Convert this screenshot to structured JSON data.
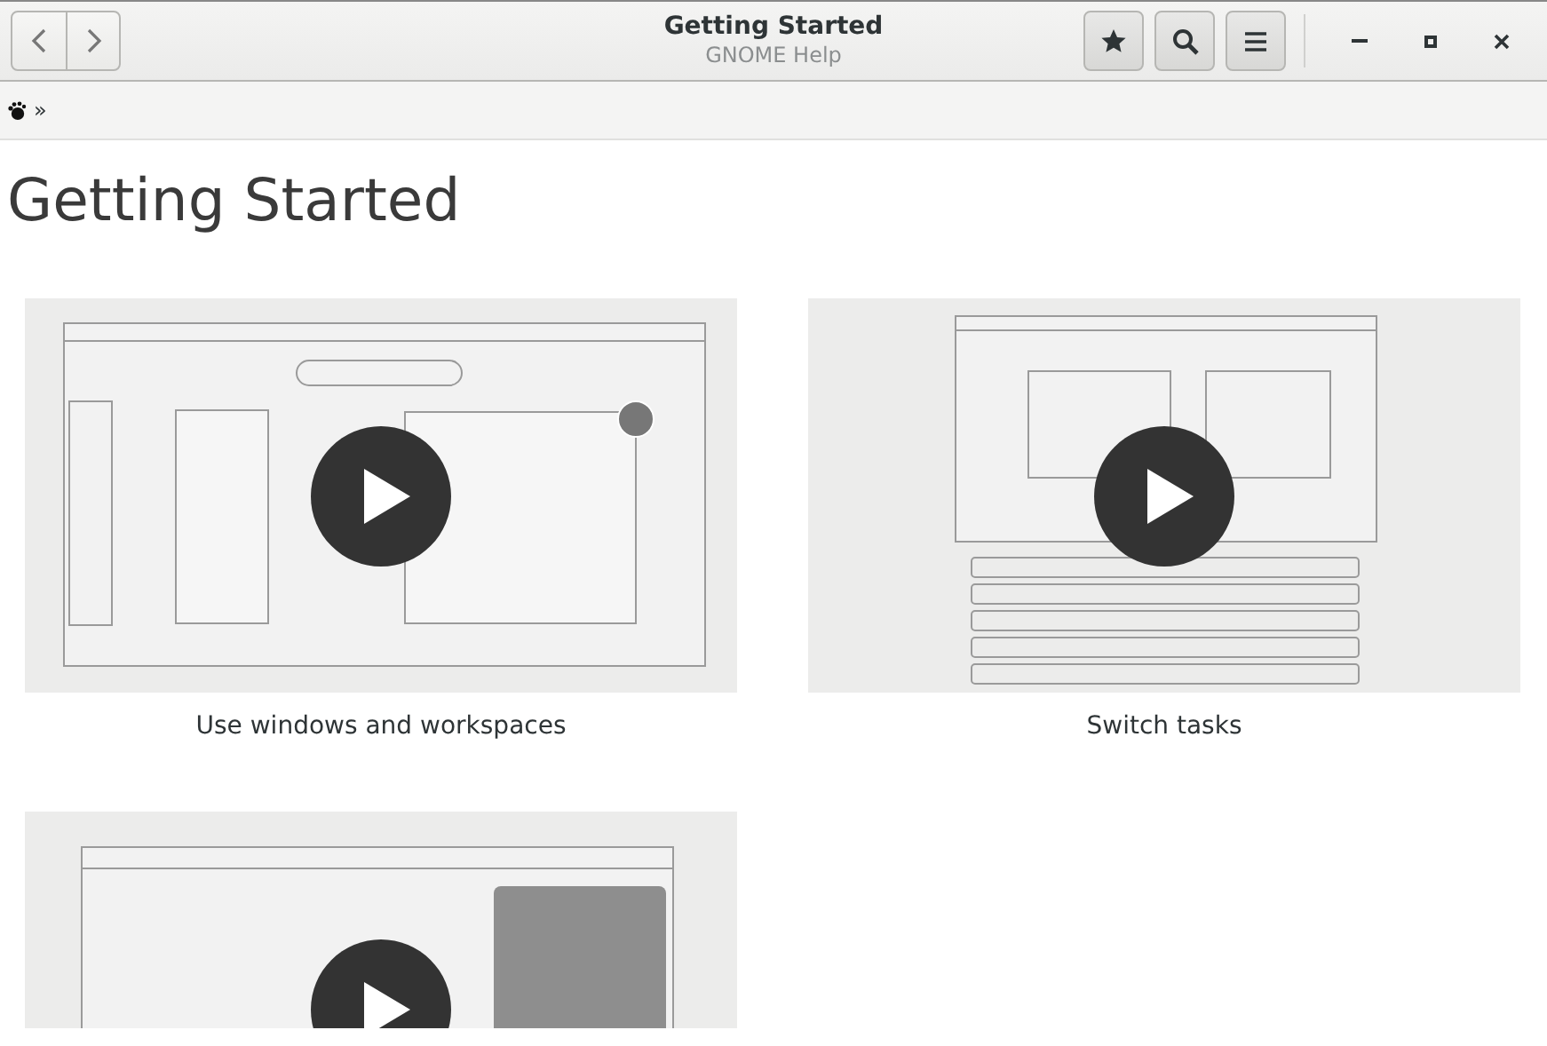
{
  "window": {
    "title": "Getting Started",
    "subtitle": "GNOME Help"
  },
  "breadcrumb": {
    "separator": "»"
  },
  "page": {
    "heading": "Getting Started"
  },
  "topics": [
    {
      "title": "Use windows and workspaces",
      "kind": "windows"
    },
    {
      "title": "Switch tasks",
      "kind": "keyboard"
    },
    {
      "kind": "panel"
    }
  ]
}
